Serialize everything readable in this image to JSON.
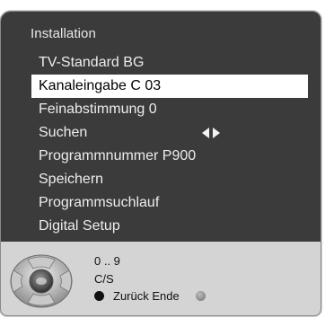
{
  "menu": {
    "title": "Installation",
    "items": [
      {
        "label": "TV-Standard BG"
      },
      {
        "label": "Kanaleingabe C 03"
      },
      {
        "label": "Feinabstimmung 0"
      },
      {
        "label": "Suchen"
      },
      {
        "label": "Programmnummer P900"
      },
      {
        "label": "Speichern"
      },
      {
        "label": "Programmsuchlauf"
      },
      {
        "label": "Digital Setup"
      }
    ],
    "selected_index": 1
  },
  "help": {
    "digits": "0 .. 9",
    "cs": "C/S",
    "back_end": "Zurück Ende"
  },
  "icons": {
    "remote": "remote-dpad-icon",
    "arrows": "left-right-arrows-icon",
    "back": "black-dot-icon",
    "info": "info-icon"
  },
  "colors": {
    "menu_bg": "#3b3b3b",
    "help_bg": "#d4d4d4",
    "highlight": "#ffffff",
    "text": "#ededed"
  }
}
